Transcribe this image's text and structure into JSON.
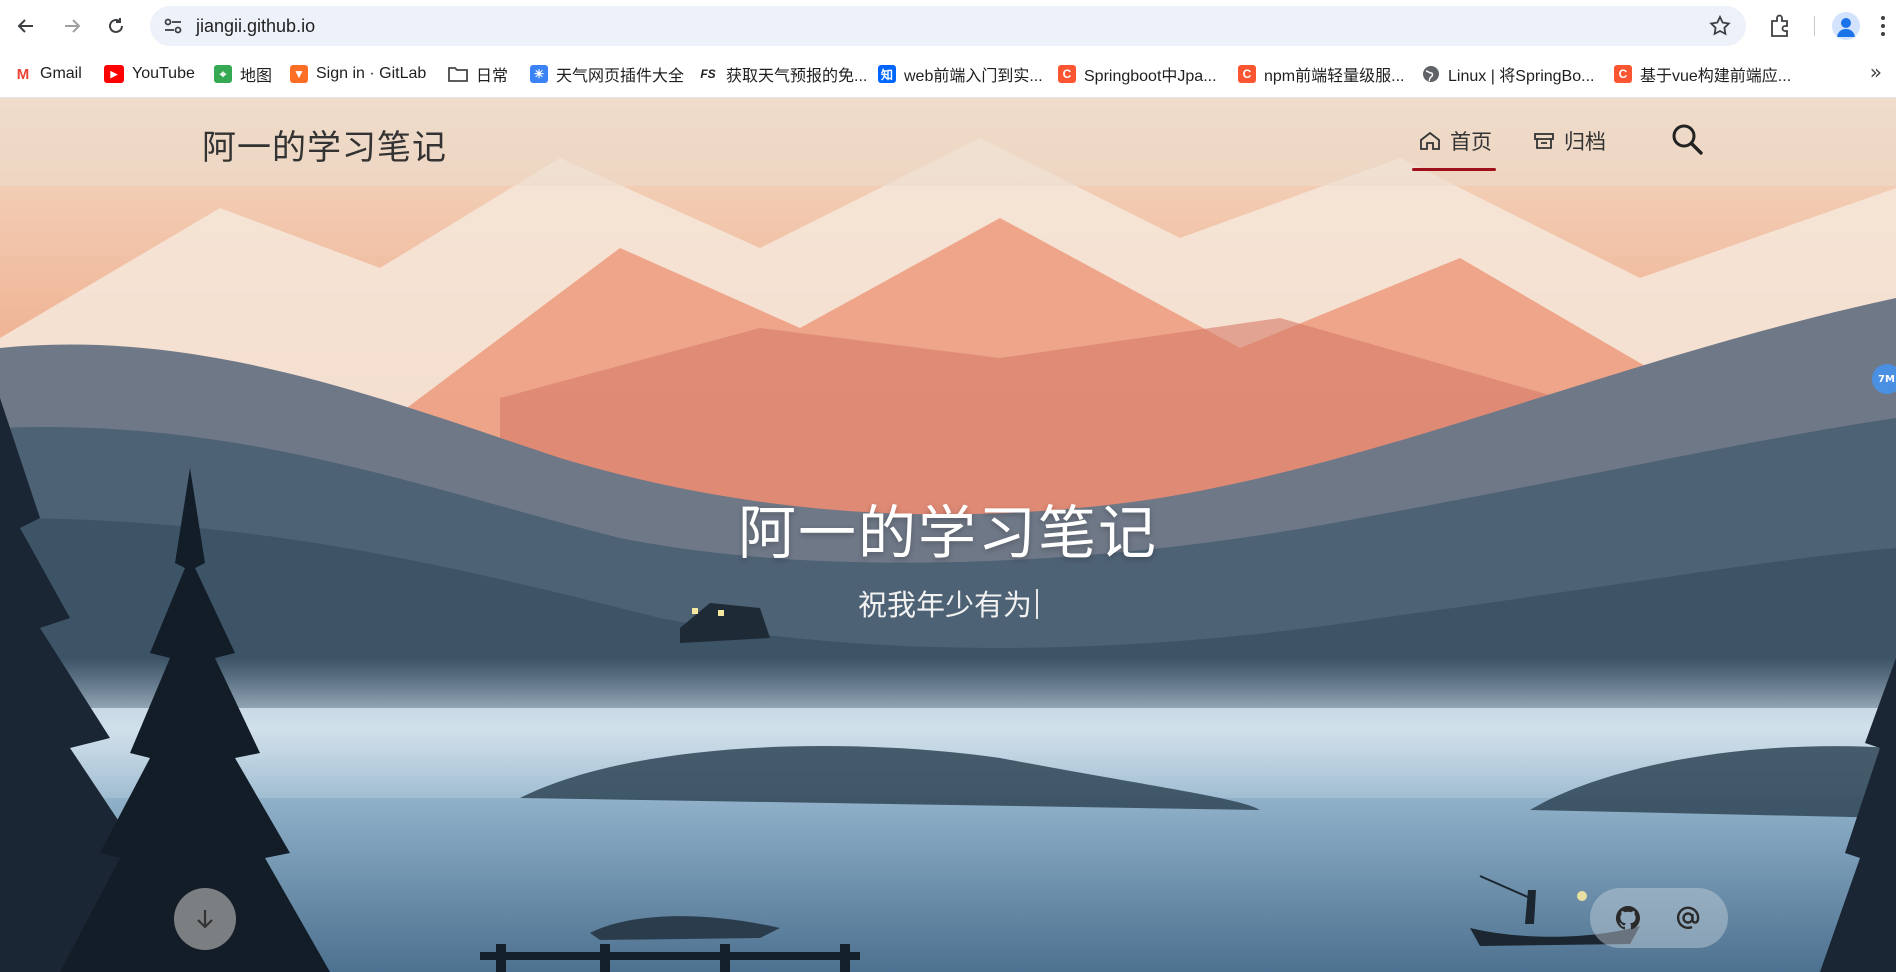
{
  "browser": {
    "url": "jiangii.github.io",
    "bookmarks": [
      {
        "label": "Gmail",
        "icon": "gmail-icon",
        "color": "#ea4335"
      },
      {
        "label": "YouTube",
        "icon": "youtube-icon",
        "color": "#ff0000"
      },
      {
        "label": "地图",
        "icon": "maps-icon",
        "color": "#34a853"
      },
      {
        "label": "Sign in · GitLab",
        "icon": "gitlab-icon",
        "color": "#fc6d26"
      },
      {
        "label": "日常",
        "icon": "folder-icon",
        "color": "#444746"
      },
      {
        "label": "天气网页插件大全",
        "icon": "weather-icon",
        "color": "#3b82f6"
      },
      {
        "label": "获取天气预报的免...",
        "icon": "fs-icon",
        "color": "#222222"
      },
      {
        "label": "web前端入门到实...",
        "icon": "zhihu-icon",
        "color": "#0066ff"
      },
      {
        "label": "Springboot中Jpa...",
        "icon": "csdn-icon",
        "color": "#fc5531"
      },
      {
        "label": "npm前端轻量级服...",
        "icon": "csdn-icon",
        "color": "#fc5531"
      },
      {
        "label": "Linux | 将SpringBo...",
        "icon": "globe-icon",
        "color": "#555555"
      },
      {
        "label": "基于vue构建前端应...",
        "icon": "csdn-icon",
        "color": "#fc5531"
      }
    ]
  },
  "site": {
    "title": "阿一的学习笔记",
    "nav": [
      {
        "label": "首页",
        "icon": "home-icon",
        "active": true
      },
      {
        "label": "归档",
        "icon": "archive-icon",
        "active": false
      }
    ],
    "accent": "#a0101a"
  },
  "hero": {
    "title": "阿一的学习笔记",
    "subtitle": "祝我年少有为"
  },
  "badge": {
    "text": "7M"
  },
  "social": [
    {
      "icon": "github-icon"
    },
    {
      "icon": "at-sign-icon"
    }
  ]
}
